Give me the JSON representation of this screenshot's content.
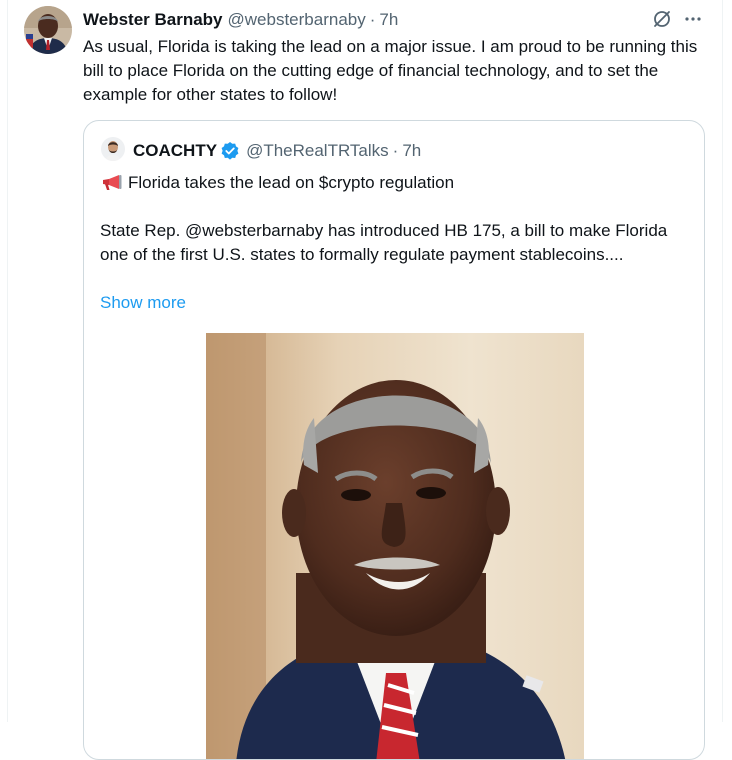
{
  "tweet": {
    "author_name": "Webster Barnaby",
    "author_handle": "@websterbarnaby",
    "separator": "·",
    "time": "7h",
    "text": "As usual, Florida is taking the lead on a major issue. I am proud to be running this bill to place Florida on the cutting edge of financial technology, and to set the example for other states to follow!",
    "icons": [
      "grok-icon",
      "more-icon"
    ]
  },
  "quote": {
    "author_name": "COACHTY",
    "author_handle": "@TheRealTRTalks",
    "separator": "·",
    "time": "7h",
    "verified": true,
    "line1": "Florida takes the lead on $crypto regulation",
    "body": "State Rep. @websterbarnaby has introduced HB 175, a bill to make Florida one of the first U.S. states to formally regulate payment stablecoins....",
    "show_more": "Show more"
  },
  "colors": {
    "text": "#0f1419",
    "secondary": "#536471",
    "link": "#1d9bf0",
    "border": "#cfd9de"
  }
}
